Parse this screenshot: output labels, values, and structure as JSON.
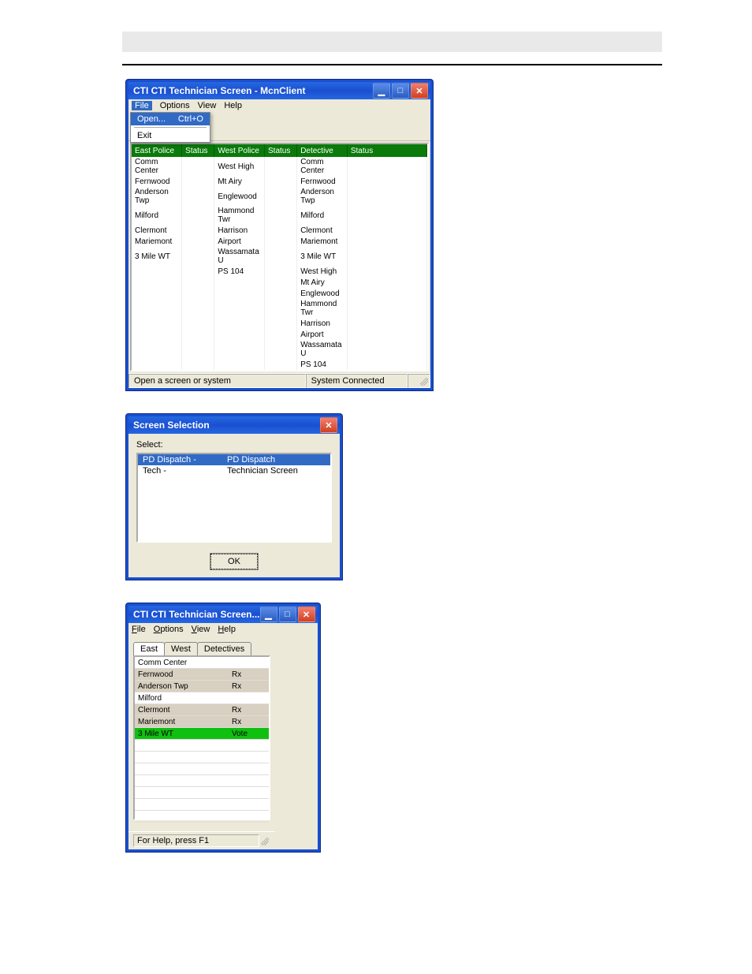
{
  "win1": {
    "title": "CTI Technician Screen - McnClient",
    "menus": {
      "file": "File",
      "options": "Options",
      "view": "View",
      "help": "Help"
    },
    "dropdown": {
      "open": "Open...",
      "open_accel": "Ctrl+O",
      "exit": "Exit"
    },
    "columns": {
      "east": "East Police",
      "status1": "Status",
      "west": "West Police",
      "status2": "Status",
      "det": "Detective",
      "status3": "Status"
    },
    "east_rows": [
      "Comm Center",
      "Fernwood",
      "Anderson Twp",
      "Milford",
      "Clermont",
      "Mariemont",
      "3 Mile WT"
    ],
    "west_rows": [
      "West High",
      "Mt Airy",
      "Englewood",
      "Hammond Twr",
      "Harrison",
      "Airport",
      "Wassamata U",
      "PS 104"
    ],
    "det_rows": [
      "Comm Center",
      "Fernwood",
      "Anderson Twp",
      "Milford",
      "Clermont",
      "Mariemont",
      "3 Mile WT",
      "West High",
      "Mt Airy",
      "Englewood",
      "Hammond Twr",
      "Harrison",
      "Airport",
      "Wassamata U",
      "PS 104"
    ],
    "status_left": "Open a screen or system",
    "status_mid": "System Connected"
  },
  "win2": {
    "title": "Screen Selection",
    "label": "Select:",
    "rows": [
      {
        "left": "PD Dispatch -",
        "right": "PD Dispatch",
        "selected": true
      },
      {
        "left": "Tech -",
        "right": "Technician Screen",
        "selected": false
      }
    ],
    "ok": "OK"
  },
  "win3": {
    "title": "CTI Technician Screen...",
    "menus": {
      "file": "File",
      "options": "Options",
      "view": "View",
      "help": "Help"
    },
    "tabs": {
      "east": "East",
      "west": "West",
      "det": "Detectives"
    },
    "rows": [
      {
        "name": "Comm Center",
        "status": ""
      },
      {
        "name": "Fernwood",
        "status": "Rx",
        "sel": true
      },
      {
        "name": "Anderson Twp",
        "status": "Rx",
        "sel": true
      },
      {
        "name": "Milford",
        "status": ""
      },
      {
        "name": "Clermont",
        "status": "Rx",
        "sel": true
      },
      {
        "name": "Mariemont",
        "status": "Rx",
        "sel": true
      },
      {
        "name": "3 Mile WT",
        "status": "Vote",
        "vote": true
      }
    ],
    "statusbar": "For Help, press F1"
  }
}
